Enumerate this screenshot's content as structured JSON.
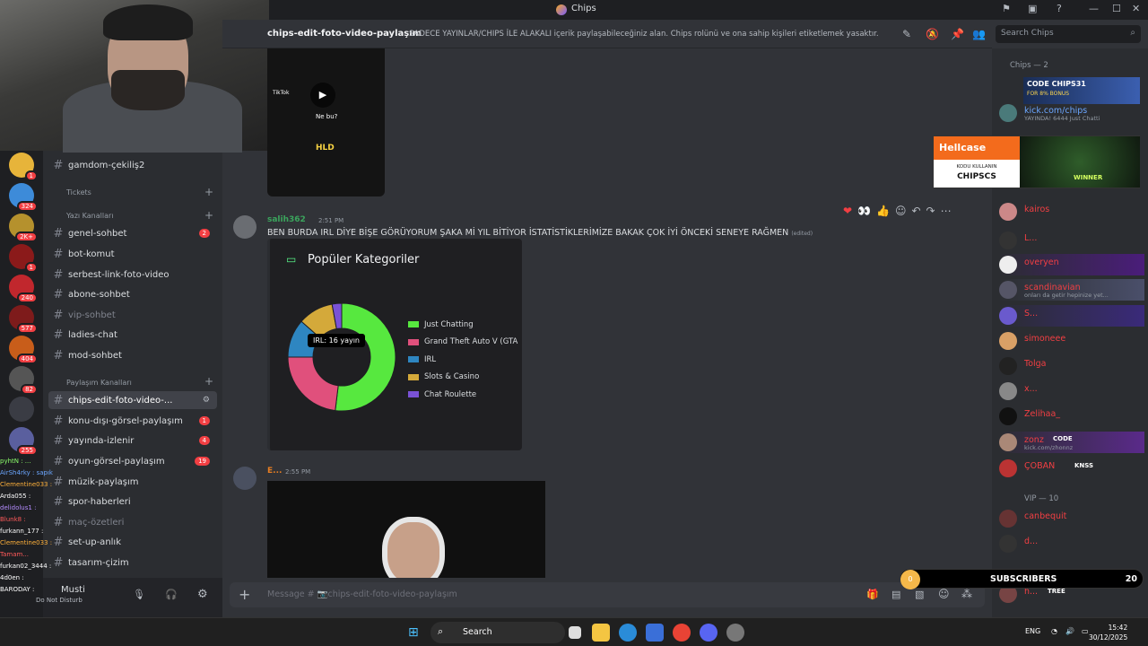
{
  "window": {
    "title": "Chips"
  },
  "header": {
    "channel": "chips-edit-foto-video-paylaşım",
    "topic": "SADECE YAYINLAR/CHIPS İLE ALAKALI içerik paylaşabileceğiniz alan. Chips rolünü ve ona sahip kişileri etiketlemek yasaktır.",
    "search_placeholder": "Search Chips"
  },
  "servers": [
    {
      "badge": "1"
    },
    {
      "badge": "324"
    },
    {
      "badge": "2K+"
    },
    {
      "badge": "1"
    },
    {
      "badge": "240"
    },
    {
      "badge": "577"
    },
    {
      "badge": "404"
    },
    {
      "badge": "82"
    },
    {
      "badge": ""
    },
    {
      "badge": "255"
    }
  ],
  "sidebar": {
    "top_channel": "gamdom-çekiliş2",
    "categories": {
      "tickets": "Tickets",
      "yazi": "Yazı Kanalları",
      "paylasim": "Paylaşım Kanalları"
    },
    "yazi_channels": [
      {
        "label": "genel-sohbet",
        "badge": "2",
        "muted": false
      },
      {
        "label": "bot-komut",
        "badge": "",
        "muted": false
      },
      {
        "label": "serbest-link-foto-video",
        "badge": "",
        "muted": false
      },
      {
        "label": "abone-sohbet",
        "badge": "",
        "muted": false
      },
      {
        "label": "vip-sohbet",
        "badge": "",
        "muted": true
      },
      {
        "label": "ladies-chat",
        "badge": "",
        "muted": false
      },
      {
        "label": "mod-sohbet",
        "badge": "",
        "muted": false
      }
    ],
    "paylasim_channels": [
      {
        "label": "chips-edit-foto-video-...",
        "badge": "",
        "muted": false,
        "active": true
      },
      {
        "label": "konu-dışı-görsel-paylaşım",
        "badge": "1",
        "muted": false
      },
      {
        "label": "yayında-izlenir",
        "badge": "4",
        "muted": false
      },
      {
        "label": "oyun-görsel-paylaşım",
        "badge": "19",
        "muted": false
      },
      {
        "label": "müzik-paylaşım",
        "badge": "",
        "muted": false
      },
      {
        "label": "spor-haberleri",
        "badge": "",
        "muted": false
      },
      {
        "label": "maç-özetleri",
        "badge": "",
        "muted": true
      },
      {
        "label": "set-up-anlık",
        "badge": "",
        "muted": false
      },
      {
        "label": "tasarım-çizim",
        "badge": "",
        "muted": false
      }
    ],
    "user": {
      "name": "Musti",
      "status": "Do Not Disturb"
    }
  },
  "stream_chat": [
    {
      "text": "pyhtN : ..."
    },
    {
      "text": "AirSh4rky : sapık"
    },
    {
      "text": "Clementine033 :"
    },
    {
      "text": "Arda055 :"
    },
    {
      "text": "delidolus1 :"
    },
    {
      "text": "Blunk8 :"
    },
    {
      "text": "furkann_177 :"
    },
    {
      "text": "Clementine033 :"
    },
    {
      "text": "Tamam..."
    },
    {
      "text": "furkan02_3444 :"
    },
    {
      "text": "4d0en :"
    },
    {
      "text": "BARODAY :"
    }
  ],
  "video1": {
    "brand": "TikTok",
    "caption": "Ne bu?",
    "watermark": "HLD"
  },
  "message1": {
    "author": "salih362",
    "time": "2:51 PM",
    "text": "BEN BURDA IRL DİYE BİŞE GÖRÜYORUM ŞAKA Mİ YIL BİTİYOR İSTATİSTİKLERİMİZE BAKAK ÇOK İYİ ÖNCEKİ SENEYE RAĞMEN",
    "edited": "(edited)"
  },
  "reactions": [
    "❤",
    "👀",
    "👍"
  ],
  "chart_data": {
    "type": "pie",
    "title": "Popüler Kategoriler",
    "categories": [
      "Just Chatting",
      "Grand Theft Auto V (GTA",
      "IRL",
      "Slots & Casino",
      "Chat Roulette"
    ],
    "values": [
      54,
      24,
      12,
      11,
      3
    ],
    "colors": [
      "#57e83f",
      "#e0507c",
      "#2e86c1",
      "#d4a93a",
      "#7a52d6"
    ],
    "tooltip": "IRL: 16 yayın",
    "legend_position": "right"
  },
  "message2": {
    "author": "E...",
    "time": "2:55 PM"
  },
  "composer": {
    "placeholder": "Message # 📷chips-edit-foto-video-paylaşım"
  },
  "members": {
    "role1": "Chips — 2",
    "role1_members": [
      {
        "name": "kick.com/chips",
        "sub": "YAYINDA! 6444 Just Chatti"
      }
    ],
    "role2_members": [
      {
        "name": "kairos",
        "sub": ""
      },
      {
        "name": "L...",
        "sub": ""
      },
      {
        "name": "overyen",
        "sub": ""
      },
      {
        "name": "scandinavian",
        "sub": "onları da getir hepinize yet..."
      },
      {
        "name": "S...",
        "sub": ""
      },
      {
        "name": "simoneee",
        "sub": ""
      },
      {
        "name": "Tolga",
        "sub": ""
      },
      {
        "name": "x...",
        "sub": ""
      },
      {
        "name": "Zelihaa_",
        "sub": ""
      },
      {
        "name": "zonz",
        "sub": "kick.com/zhonnz",
        "tag": "CODE"
      },
      {
        "name": "ÇOBAN",
        "sub": "",
        "tag": "KNSS"
      }
    ],
    "role2": "VIP — 10",
    "vip_members": [
      {
        "name": "canbequit",
        "sub": ""
      },
      {
        "name": "d...",
        "sub": ""
      },
      {
        "name": "h...",
        "sub": "",
        "tag": "TREE"
      }
    ],
    "code_banner": {
      "line1": "CODE CHIPS31",
      "line2": "FOR 8% BONUS"
    }
  },
  "ad": {
    "brand": "Hellcase",
    "line1": "KODU KULLANIN",
    "line2": "CHIPSCS",
    "win": "WINNER"
  },
  "subscribers": {
    "label": "SUBSCRIBERS",
    "count": "20",
    "progress": "0"
  },
  "taskbar": {
    "search": "Search",
    "lang": "ENG",
    "time": "15:42",
    "date": "30/12/2025"
  }
}
